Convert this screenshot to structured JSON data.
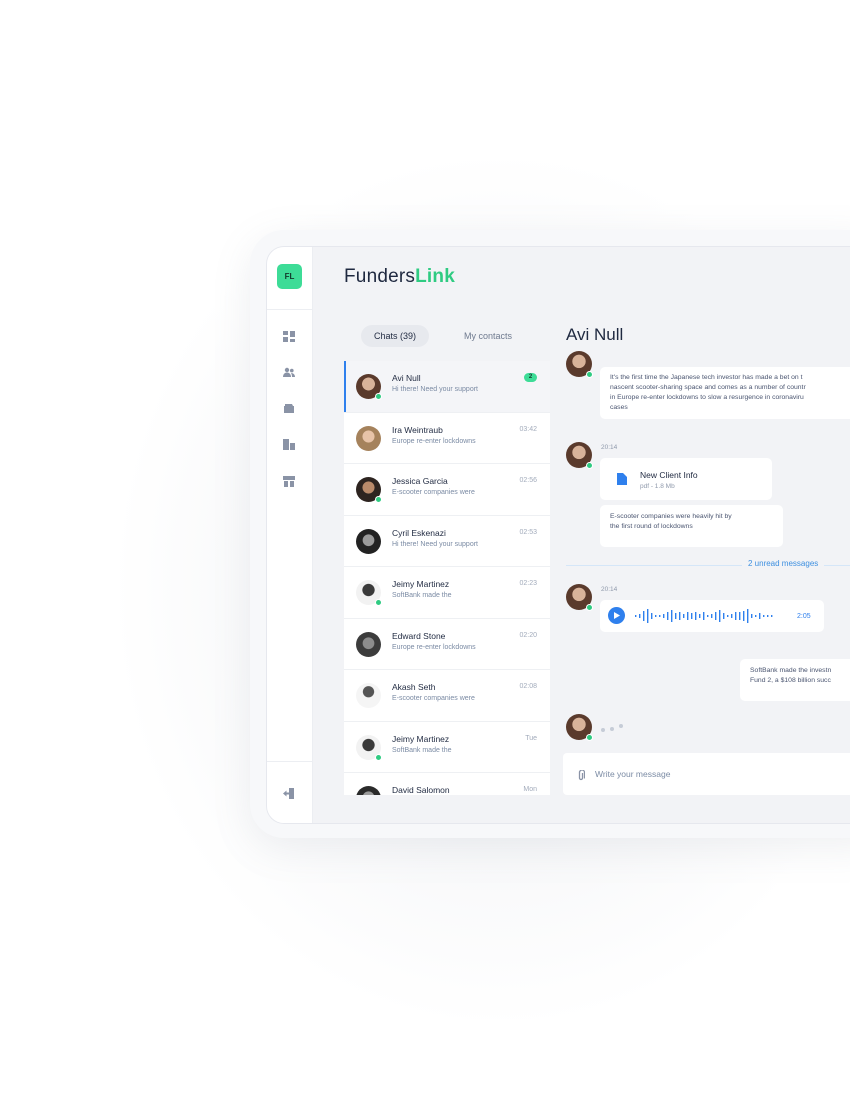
{
  "brand": {
    "name_part1": "Funders",
    "name_part2": "Link",
    "logo_initials": "FL"
  },
  "tabs": {
    "chats": "Chats (39)",
    "contacts": "My contacts"
  },
  "nav": {
    "items": [
      "dashboard-icon",
      "users-icon",
      "wallet-icon",
      "companies-icon",
      "store-icon"
    ],
    "logout": "logout-icon"
  },
  "chats": [
    {
      "name": "Avi Null",
      "preview": "Hi there! Need your support",
      "badge": "2",
      "time": "",
      "online": true,
      "selected": true
    },
    {
      "name": "Ira Weintraub",
      "preview": "Europe re-enter lockdowns",
      "time": "03:42",
      "online": false
    },
    {
      "name": "Jessica Garcia",
      "preview": "E-scooter companies were",
      "time": "02:56",
      "online": true
    },
    {
      "name": "Cyril Eskenazi",
      "preview": "Hi there! Need your support",
      "time": "02:53",
      "online": false
    },
    {
      "name": "Jeimy Martinez",
      "preview": "SoftBank made the",
      "time": "02:23",
      "online": true
    },
    {
      "name": "Edward Stone",
      "preview": "Europe re-enter lockdowns",
      "time": "02:20",
      "online": false
    },
    {
      "name": "Akash Seth",
      "preview": "E-scooter companies were",
      "time": "02:08",
      "online": false
    },
    {
      "name": "Jeimy Martinez",
      "preview": "SoftBank made the",
      "time": "Tue",
      "online": true
    },
    {
      "name": "David Salomon",
      "preview": "",
      "time": "Mon",
      "online": false
    }
  ],
  "conversation": {
    "title": "Avi Null",
    "msg1": "It's the first time the Japanese tech investor has made a bet on t nascent scooter-sharing space and comes as a number of countr in Europe re-enter lockdowns to slow a resurgence in coronaviru cases",
    "msg1_lines": [
      "It's the first time the Japanese tech investor has made a bet on t",
      "nascent scooter-sharing space and comes as a number of countr",
      "in Europe re-enter lockdowns to slow a resurgence in coronaviru",
      "cases"
    ],
    "time2": "20:14",
    "file_name": "New Client Info",
    "file_meta": "pdf - 1.8 Mb",
    "msg3_lines": [
      "E-scooter companies were heavily hit by",
      "the first round of lockdowns"
    ],
    "unread": "2 unread messages",
    "time3": "20:14",
    "voice_duration": "2:05",
    "msg_out_lines": [
      "SoftBank made the investn",
      "Fund 2, a $108 billion succ"
    ]
  },
  "composer": {
    "placeholder": "Write your message"
  },
  "colors": {
    "accent_green": "#3ddc97",
    "accent_blue": "#2f80ed"
  }
}
